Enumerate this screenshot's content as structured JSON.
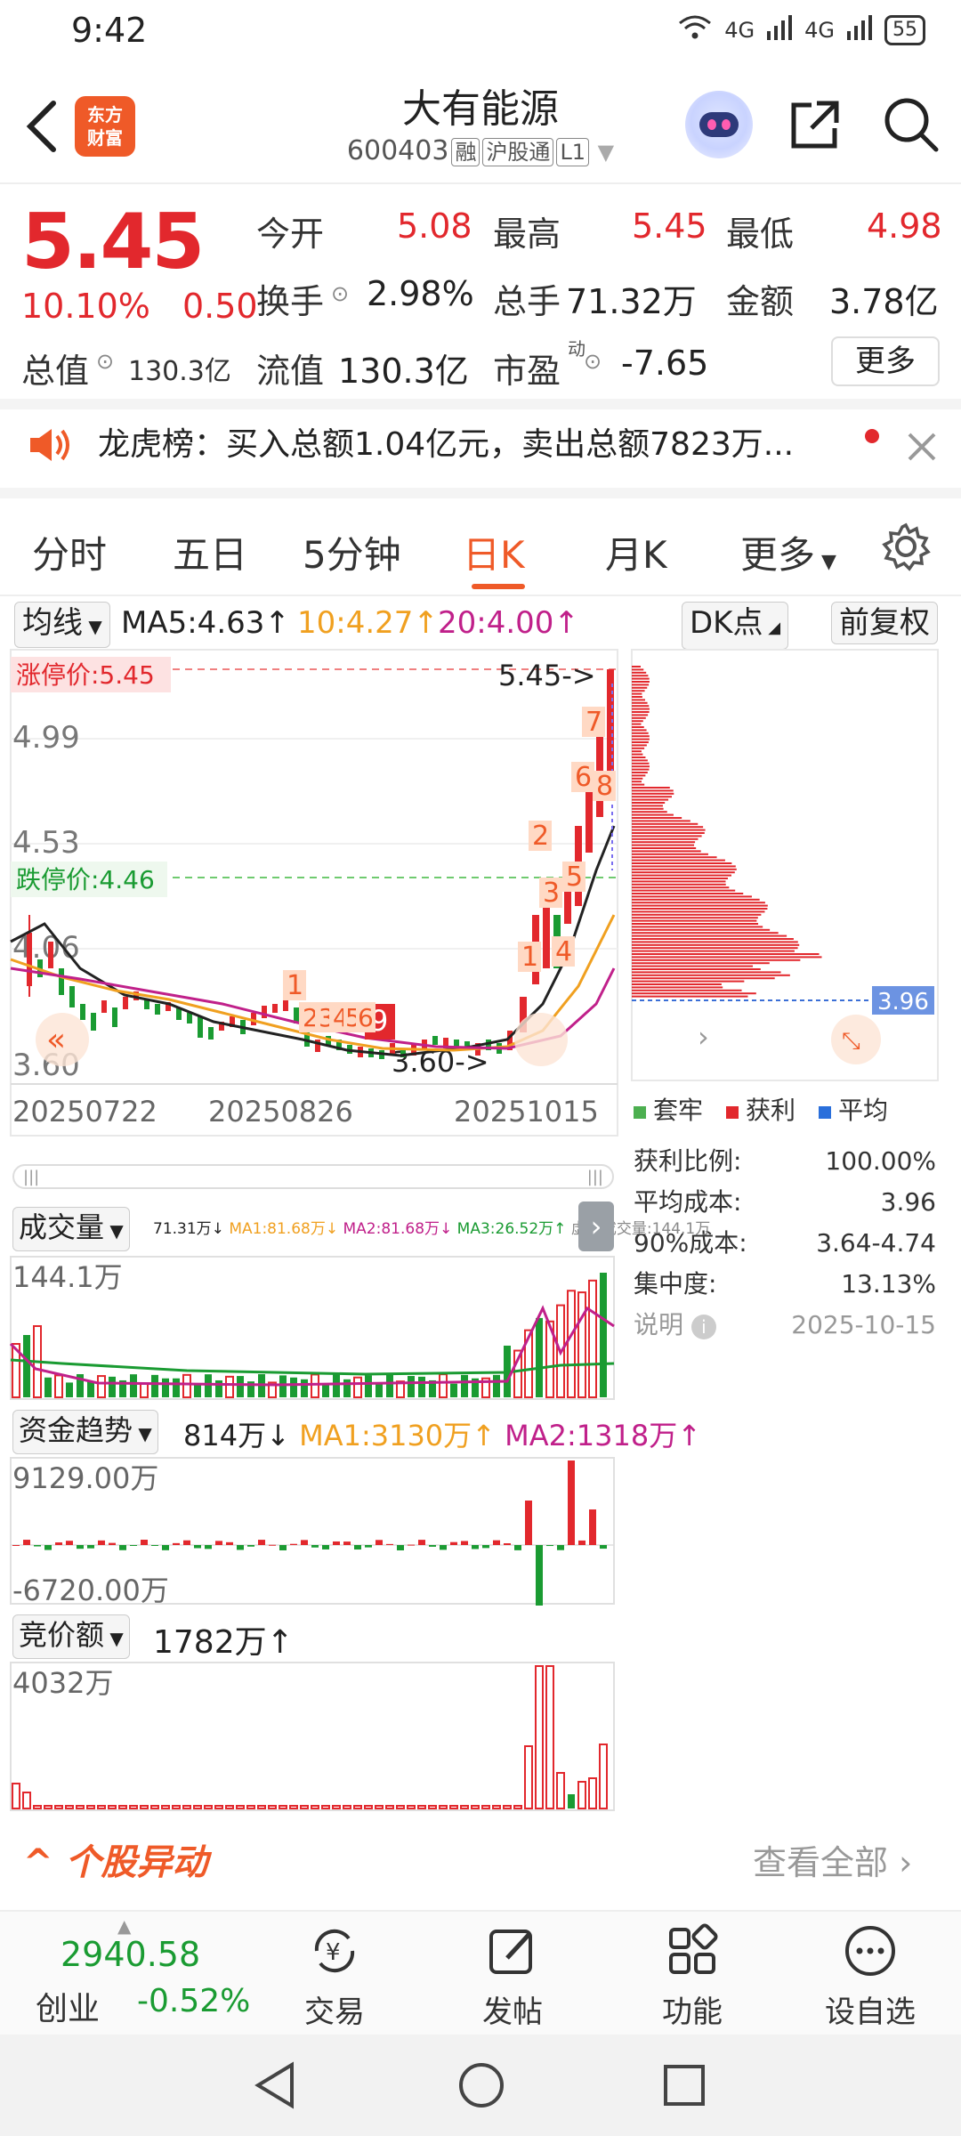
{
  "status": {
    "time": "9:42",
    "net1": "4G",
    "net2": "4G",
    "battery": "55"
  },
  "header": {
    "logo_line1": "东方",
    "logo_line2": "财富",
    "stock_name": "大有能源",
    "code": "600403",
    "tags": [
      "融",
      "沪股通",
      "L1"
    ]
  },
  "quote": {
    "price": "5.45",
    "change_pct": "10.10%",
    "change_amt": "0.50",
    "open_label": "今开",
    "open": "5.08",
    "high_label": "最高",
    "high": "5.45",
    "low_label": "最低",
    "low": "4.98",
    "turnover_label": "换手",
    "turnover": "2.98%",
    "volume_label": "总手",
    "volume": "71.32万",
    "amount_label": "金额",
    "amount": "3.78亿",
    "mktcap_label": "总值",
    "mktcap": "130.3亿",
    "float_label": "流值",
    "float_cap": "130.3亿",
    "pe_label": "市盈",
    "pe_sup": "动",
    "pe": "-7.65",
    "more_label": "更多"
  },
  "announcement": {
    "text": "龙虎榜：买入总额1.04亿元，卖出总额7823万..."
  },
  "tabs": [
    "分时",
    "五日",
    "5分钟",
    "日K",
    "月K",
    "更多"
  ],
  "active_tab": "日K",
  "toolbar": {
    "ma_select": "均线",
    "ma5": "MA5:4.63↑",
    "ma10": "10:4.27↑",
    "ma20": "20:4.00↑",
    "dk_label": "DK点",
    "adjust_label": "前复权"
  },
  "kchart": {
    "limit_up_label": "涨停价:5.45",
    "limit_down_label": "跌停价:4.46",
    "y_ticks": [
      "4.99",
      "4.53",
      "4.06",
      "3.60"
    ],
    "high_marker": "5.45->",
    "low_marker": "3.60->",
    "x_labels": [
      "20250722",
      "20250826",
      "20251015"
    ],
    "markers": [
      "1",
      "2",
      "3",
      "4",
      "5",
      "6",
      "7",
      "8",
      "9"
    ]
  },
  "chip_dist": {
    "avg_label": "3.96",
    "legend": [
      "套牢",
      "获利",
      "平均"
    ],
    "stats": [
      {
        "label": "获利比例:",
        "value": "100.00%"
      },
      {
        "label": "平均成本:",
        "value": "3.96"
      },
      {
        "label": "90%成本:",
        "value": "3.64-4.74"
      },
      {
        "label": "集中度:",
        "value": "13.13%"
      }
    ],
    "note_label": "说明",
    "date": "2025-10-15"
  },
  "volume_panel": {
    "select": "成交量",
    "legend": "71.31万↓",
    "ma1": "MA1:81.68万↓",
    "ma2": "MA2:81.68万↓",
    "ma3": "MA3:26.52万↑",
    "virtual": "虚拟成交量:144.1万",
    "max_label": "144.1万"
  },
  "fund_panel": {
    "select": "资金趋势",
    "value": "814万↓",
    "ma1": "MA1:3130万↑",
    "ma2": "MA2:1318万↑",
    "max_label": "9129.00万",
    "min_label": "-6720.00万"
  },
  "auction_panel": {
    "select": "竞价额",
    "value": "1782万↑",
    "max_label": "4032万"
  },
  "section": {
    "title": "个股异动",
    "view_all": "查看全部"
  },
  "bottom_nav": {
    "index_value": "2940.58",
    "index_name": "创业",
    "index_change": "-0.52%",
    "items": [
      "交易",
      "发帖",
      "功能",
      "设自选"
    ]
  },
  "colors": {
    "up": "#e2282d",
    "down": "#1a9b32",
    "accent": "#ef5a28"
  }
}
